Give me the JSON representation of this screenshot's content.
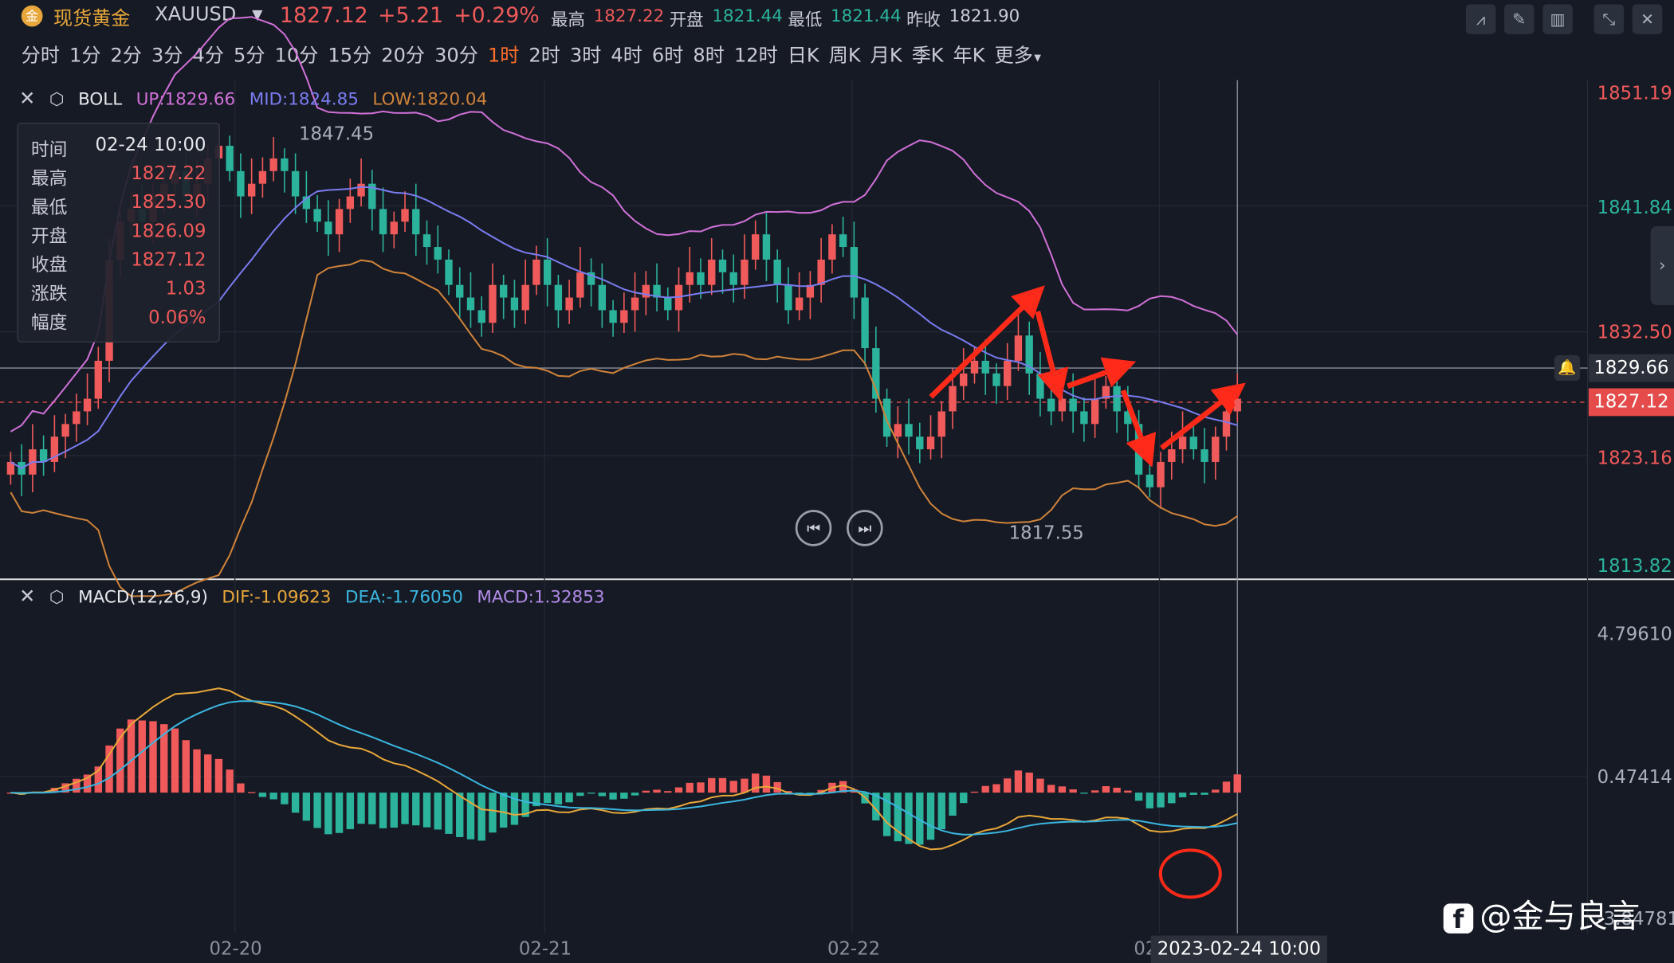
{
  "header": {
    "name": "现货黄金",
    "symbol": "XAUUSD",
    "price": "1827.12",
    "change": "+5.21",
    "change_pct": "+0.29%",
    "high_label": "最高",
    "high": "1827.22",
    "open_label": "开盘",
    "open": "1821.44",
    "low_label": "最低",
    "low": "1821.44",
    "prev_label": "昨收",
    "prev": "1821.90"
  },
  "periods": [
    "分时",
    "1分",
    "2分",
    "3分",
    "4分",
    "5分",
    "10分",
    "15分",
    "20分",
    "30分",
    "1时",
    "2时",
    "3时",
    "4时",
    "6时",
    "8时",
    "12时",
    "日K",
    "周K",
    "月K",
    "季K",
    "年K",
    "更多"
  ],
  "active_period": "1时",
  "boll": {
    "name": "BOLL",
    "up": "UP:1829.66",
    "mid": "MID:1824.85",
    "low": "LOW:1820.04"
  },
  "ohlc": {
    "rows": [
      {
        "k": "时间",
        "v": "02-24 10:00"
      },
      {
        "k": "最高",
        "v": "1827.22"
      },
      {
        "k": "最低",
        "v": "1825.30"
      },
      {
        "k": "开盘",
        "v": "1826.09"
      },
      {
        "k": "收盘",
        "v": "1827.12"
      },
      {
        "k": "涨跌",
        "v": "1.03"
      },
      {
        "k": "幅度",
        "v": "0.06%"
      }
    ]
  },
  "price_axis": [
    "1851.19",
    "1841.84",
    "1832.50",
    "1823.16",
    "1813.82"
  ],
  "crosshair_price": "1829.66",
  "current_price": "1827.12",
  "annotations": {
    "high": "1847.45",
    "low": "1817.55"
  },
  "macd": {
    "name": "MACD(12,26,9)",
    "dif": "DIF:-1.09623",
    "dea": "DEA:-1.76050",
    "macd": "MACD:1.32853"
  },
  "macd_axis": [
    "4.79610",
    "0.47414",
    "-3.84781"
  ],
  "dates": [
    "02-20",
    "02-21",
    "02-22",
    "02"
  ],
  "crosshair_time": "2023-02-24 10:00",
  "watermark": "@金与良言",
  "colors": {
    "up": "#f05a5a",
    "down": "#2bb39c",
    "mid": "#7a7cf0",
    "upper": "#d070d8",
    "lower": "#d0833a",
    "arrow": "#ff2a1a"
  }
}
